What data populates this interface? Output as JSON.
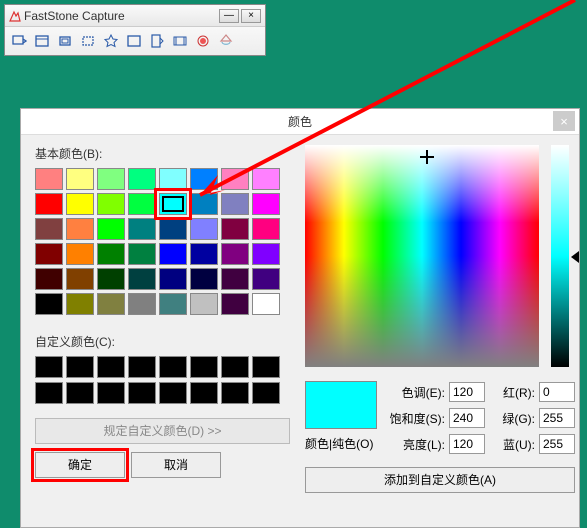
{
  "fs": {
    "title": "FastStone Capture",
    "min": "—",
    "close": "×"
  },
  "dlg": {
    "title": "颜色",
    "close": "×",
    "basic_label": "基本颜色(B):",
    "custom_label": "自定义颜色(C):",
    "define_btn": "规定自定义颜色(D) >>",
    "ok": "确定",
    "cancel": "取消",
    "preview_label": "颜色|纯色(O)",
    "add_btn": "添加到自定义颜色(A)",
    "fields": {
      "hue_l": "色调(E):",
      "hue_v": "120",
      "sat_l": "饱和度(S):",
      "sat_v": "240",
      "lum_l": "亮度(L):",
      "lum_v": "120",
      "r_l": "红(R):",
      "r_v": "0",
      "g_l": "绿(G):",
      "g_v": "255",
      "b_l": "蓝(U):",
      "b_v": "255"
    },
    "basic_colors": [
      "#ff8080",
      "#ffff80",
      "#80ff80",
      "#00ff80",
      "#80ffff",
      "#0080ff",
      "#ff80c0",
      "#ff80ff",
      "#ff0000",
      "#ffff00",
      "#80ff00",
      "#00ff40",
      "#00ffff",
      "#0080c0",
      "#8080c0",
      "#ff00ff",
      "#804040",
      "#ff8040",
      "#00ff00",
      "#008080",
      "#004080",
      "#8080ff",
      "#800040",
      "#ff0080",
      "#800000",
      "#ff8000",
      "#008000",
      "#008040",
      "#0000ff",
      "#0000a0",
      "#800080",
      "#8000ff",
      "#400000",
      "#804000",
      "#004000",
      "#004040",
      "#000080",
      "#000040",
      "#400040",
      "#400080",
      "#000000",
      "#808000",
      "#808040",
      "#808080",
      "#408080",
      "#c0c0c0",
      "#400040",
      "#ffffff"
    ],
    "selected_index": 12
  },
  "chart_data": {
    "type": "table",
    "title": "Selected Color HSL/RGB",
    "series": [
      {
        "name": "Hue",
        "values": [
          120
        ]
      },
      {
        "name": "Saturation",
        "values": [
          240
        ]
      },
      {
        "name": "Luminance",
        "values": [
          120
        ]
      },
      {
        "name": "Red",
        "values": [
          0
        ]
      },
      {
        "name": "Green",
        "values": [
          255
        ]
      },
      {
        "name": "Blue",
        "values": [
          255
        ]
      }
    ]
  }
}
